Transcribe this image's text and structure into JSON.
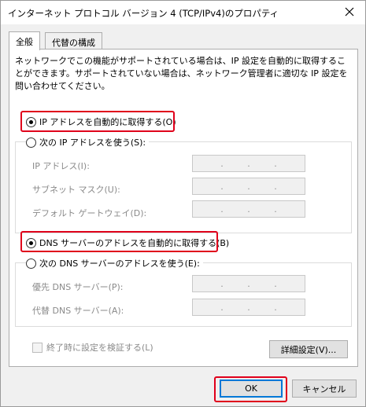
{
  "window": {
    "title": "インターネット プロトコル バージョン 4 (TCP/IPv4)のプロパティ",
    "close_icon": "close-icon"
  },
  "tabs": [
    {
      "label": "全般",
      "active": true
    },
    {
      "label": "代替の構成",
      "active": false
    }
  ],
  "description": "ネットワークでこの機能がサポートされている場合は、IP 設定を自動的に取得することができます。サポートされていない場合は、ネットワーク管理者に適切な IP 設定を問い合わせてください。",
  "ip_section": {
    "auto_label": "IP アドレスを自動的に取得する(O)",
    "auto_selected": true,
    "manual_label": "次の IP アドレスを使う(S):",
    "manual_selected": false,
    "fields": [
      {
        "label": "IP アドレス(I):",
        "value": ". . ."
      },
      {
        "label": "サブネット マスク(U):",
        "value": ". . ."
      },
      {
        "label": "デフォルト ゲートウェイ(D):",
        "value": ". . ."
      }
    ]
  },
  "dns_section": {
    "auto_label": "DNS サーバーのアドレスを自動的に取得する(B)",
    "auto_selected": true,
    "manual_label": "次の DNS サーバーのアドレスを使う(E):",
    "manual_selected": false,
    "fields": [
      {
        "label": "優先 DNS サーバー(P):",
        "value": ". . ."
      },
      {
        "label": "代替 DNS サーバー(A):",
        "value": ". . ."
      }
    ]
  },
  "validate_checkbox": {
    "label": "終了時に設定を検証する(L)",
    "checked": false
  },
  "advanced_button": "詳細設定(V)...",
  "ok_button": "OK",
  "cancel_button": "キャンセル",
  "colors": {
    "highlight": "#e0001b",
    "accent": "#0078d7"
  }
}
